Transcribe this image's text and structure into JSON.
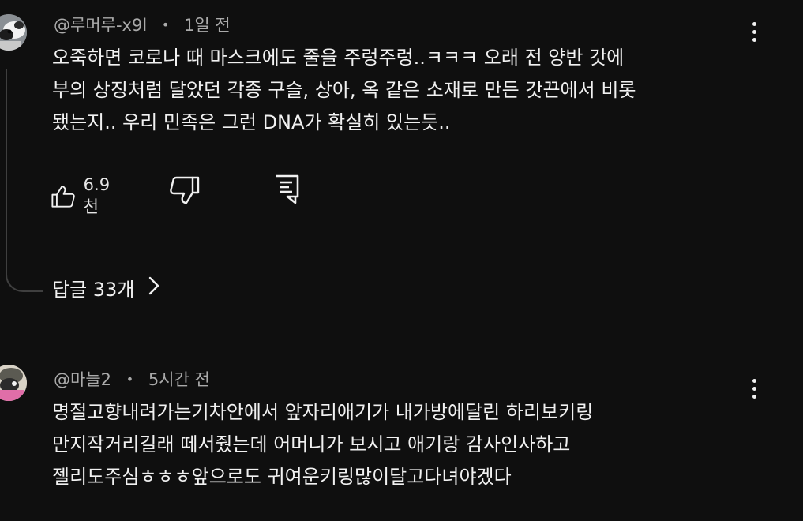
{
  "comments": [
    {
      "author": "@루머루-x9l",
      "time": "1일 전",
      "lines": [
        "오죽하면 코로나 때 마스크에도 줄을 주렁주렁..ㅋㅋㅋ 오래 전 양반 갓에",
        "부의 상징처럼 달았던 각종 구슬, 상아, 옥 같은 소재로 만든 갓끈에서 비롯",
        "됐는지.. 우리 민족은 그런 DNA가 확실히 있는듯.."
      ],
      "likes": "6.9천",
      "replies_label": "답글 33개"
    },
    {
      "author": "@마늘2",
      "time": "5시간 전",
      "lines": [
        "명절고향내려가는기차안에서 앞자리애기가 내가방에달린 하리보키링",
        "만지작거리길래 떼서줬는데 어머니가 보시고 애기랑 감사인사하고",
        "젤리도주심ㅎㅎㅎ앞으로도 귀여운키링많이달고다녀야겠다"
      ]
    }
  ],
  "separator": "•",
  "icons": {
    "like": "thumbs-up-icon",
    "dislike": "thumbs-down-icon",
    "reply": "reply-comment-icon",
    "more": "more-vertical-icon",
    "chevron": "chevron-right-icon"
  },
  "colors": {
    "background": "#0f0f0f",
    "text": "#f1f1f1",
    "meta": "#aaaaaa",
    "thread": "#3f3f3f"
  }
}
